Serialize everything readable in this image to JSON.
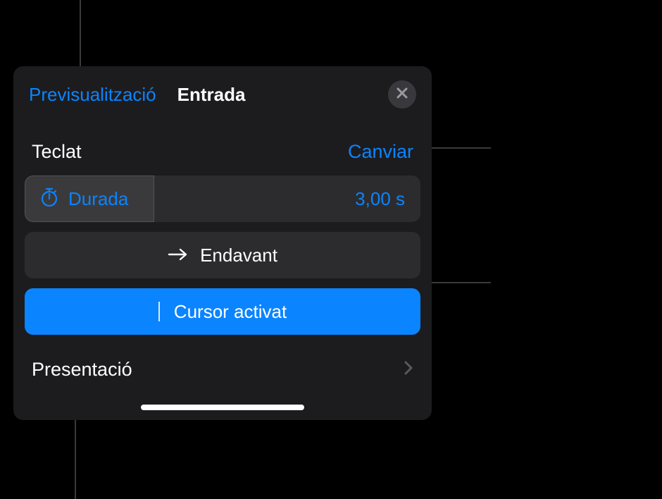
{
  "header": {
    "preview_label": "Previsualització",
    "title": "Entrada"
  },
  "section": {
    "label": "Teclat",
    "action": "Canviar"
  },
  "duration": {
    "label": "Durada",
    "value": "3,00 s"
  },
  "direction": {
    "label": "Endavant"
  },
  "active": {
    "label": "Cursor activat"
  },
  "footer": {
    "label": "Presentació"
  }
}
